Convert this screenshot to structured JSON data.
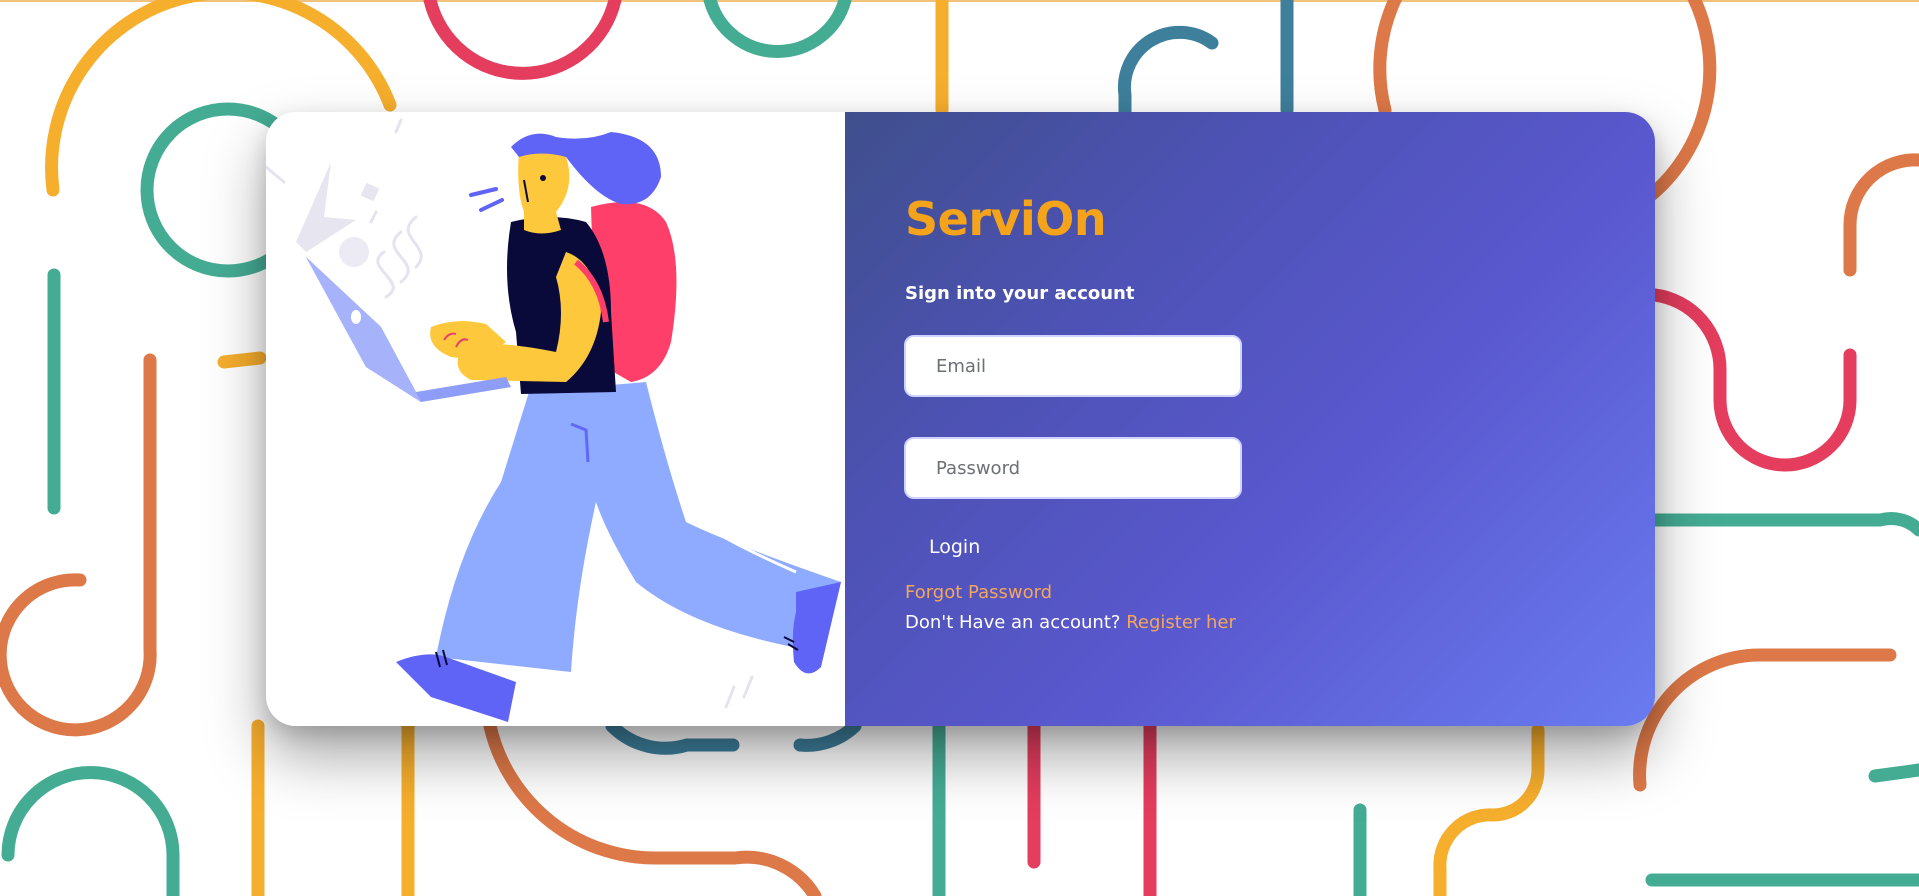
{
  "brand": {
    "name": "ServiOn",
    "color": "#f5a31a"
  },
  "form": {
    "subtitle": "Sign into your account",
    "email_placeholder": "Email",
    "password_placeholder": "Password",
    "login_label": "Login",
    "forgot_label": "Forgot Password",
    "register_prompt": "Don't Have an account?",
    "register_label": "Register her"
  },
  "colors": {
    "panel_gradient_start": "#3f4f8c",
    "panel_gradient_end": "#6a7bf0",
    "link": "#f5a65b",
    "bg_orange": "#f6ae2d",
    "bg_green": "#45ac94",
    "bg_red": "#e43d5e",
    "bg_burnt": "#dd7848",
    "bg_teal": "#3e7f9c"
  },
  "illustration": {
    "subject": "person-with-laptop-and-backpack"
  }
}
